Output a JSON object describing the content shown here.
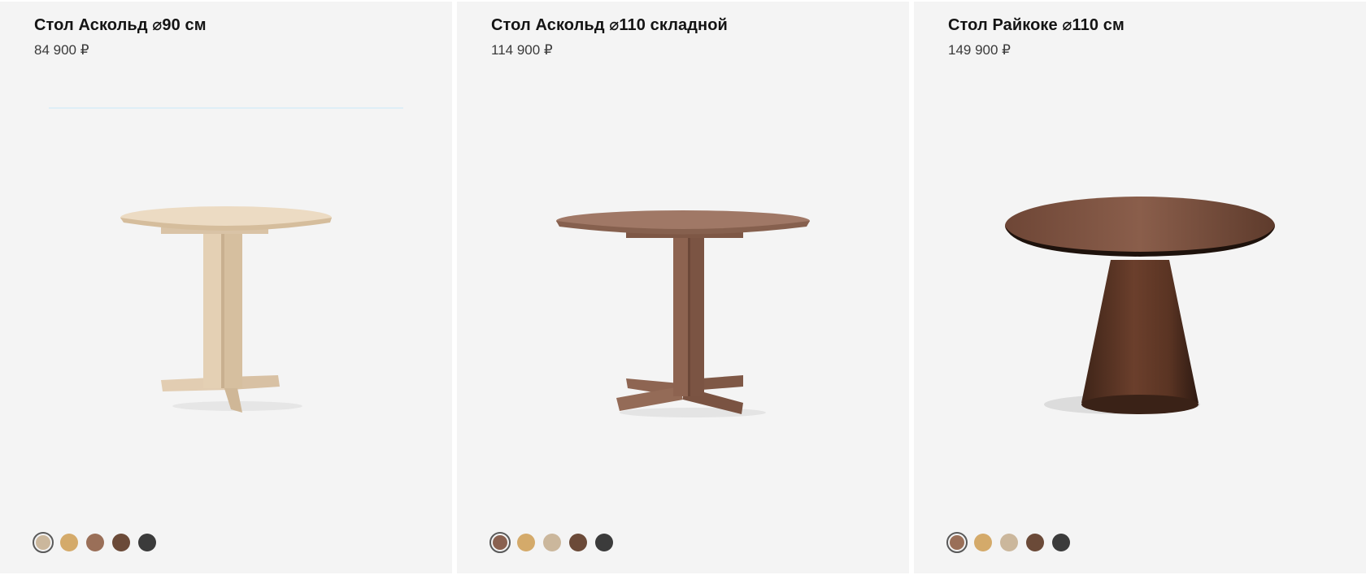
{
  "products": [
    {
      "title": "Стол Аскольд ⌀90 см",
      "price": "84 900 ₽",
      "image": "light-oak-round-table-cross-base",
      "swatches": [
        {
          "color": "#cbb79c",
          "selected": true
        },
        {
          "color": "#d4aa6a",
          "selected": false
        },
        {
          "color": "#9a6f58",
          "selected": false
        },
        {
          "color": "#6b4a38",
          "selected": false
        },
        {
          "color": "#3b3b3b",
          "selected": false
        }
      ]
    },
    {
      "title": "Стол Аскольд ⌀110 складной",
      "price": "114 900 ₽",
      "image": "walnut-round-table-cross-base",
      "swatches": [
        {
          "color": "#8a6150",
          "selected": true
        },
        {
          "color": "#d4aa6a",
          "selected": false
        },
        {
          "color": "#cbb79c",
          "selected": false
        },
        {
          "color": "#6b4a38",
          "selected": false
        },
        {
          "color": "#3b3b3b",
          "selected": false
        }
      ]
    },
    {
      "title": "Стол Райкоке ⌀110 см",
      "price": "149 900 ₽",
      "image": "dark-walnut-round-table-cone-base",
      "swatches": [
        {
          "color": "#9a6f58",
          "selected": true
        },
        {
          "color": "#d4aa6a",
          "selected": false
        },
        {
          "color": "#cbb79c",
          "selected": false
        },
        {
          "color": "#6b4a38",
          "selected": false
        },
        {
          "color": "#3b3b3b",
          "selected": false
        }
      ]
    }
  ]
}
